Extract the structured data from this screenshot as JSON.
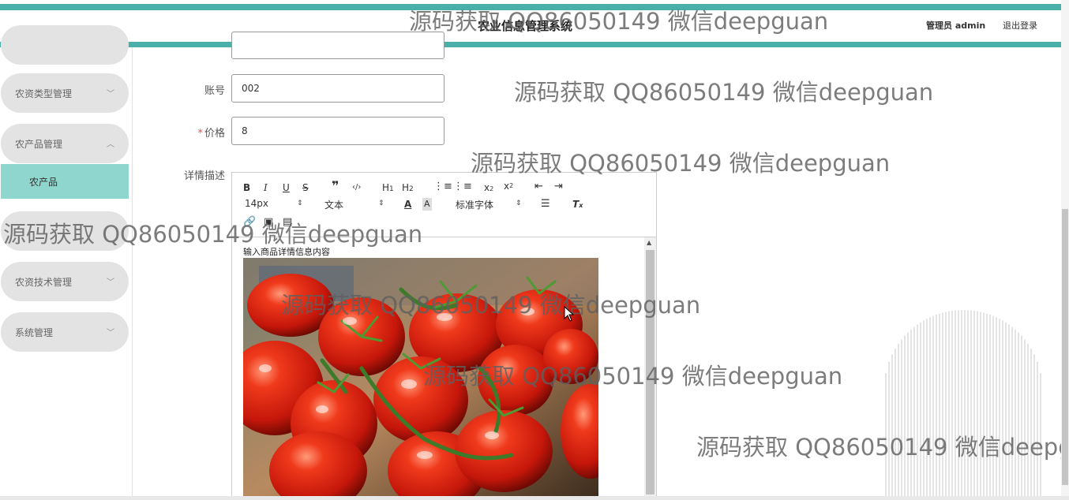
{
  "header": {
    "title": "农业信息管理系统",
    "admin": "管理员 admin",
    "logout": "退出登录"
  },
  "sidebar": {
    "items": [
      {
        "label": "农资类型管理"
      },
      {
        "label": "农产品管理"
      },
      {
        "label": "农资技术管理"
      },
      {
        "label": "系统管理"
      }
    ],
    "active_sub": "农产品"
  },
  "form": {
    "account_label": "账号",
    "account_value": "002",
    "price_label": "价格",
    "price_required": "*",
    "price_value": "8",
    "detail_label": "详情描述"
  },
  "editor": {
    "font_size": "14px",
    "format": "文本",
    "font_family": "标准字体",
    "placeholder": "输入商品详情信息内容"
  },
  "watermark": "源码获取 QQ86050149 微信deepguan",
  "colors": {
    "accent": "#4aafa8",
    "active_submenu": "#8fd6cf",
    "menu_bg": "#e3e3e3",
    "required": "#e5534b"
  }
}
